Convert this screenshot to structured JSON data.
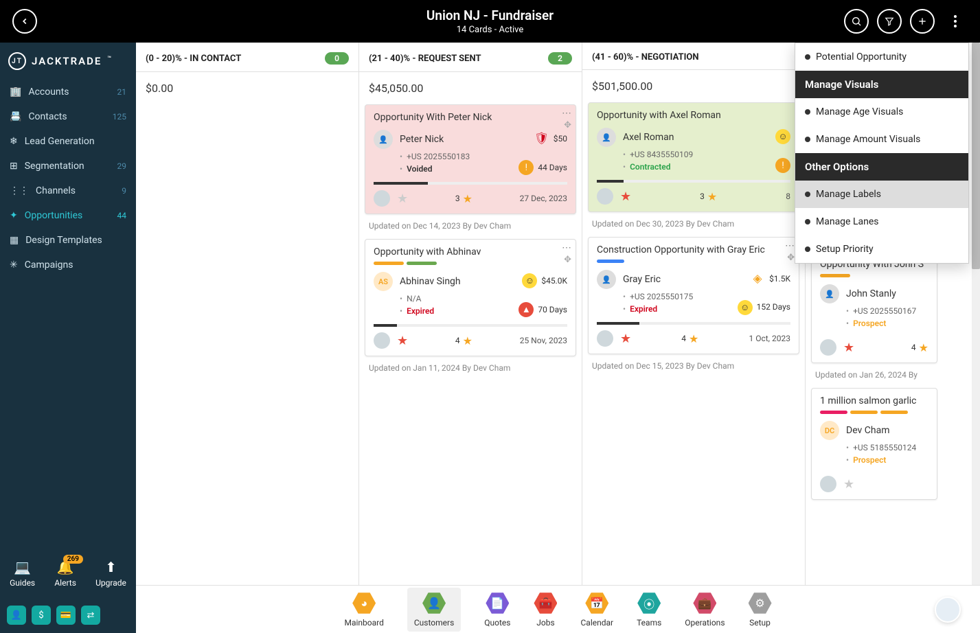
{
  "header": {
    "title": "Union NJ - Fundraiser",
    "subtitle": "14 Cards - Active"
  },
  "brand": "JACKTRADE",
  "sidebar": [
    {
      "label": "Accounts",
      "count": "21"
    },
    {
      "label": "Contacts",
      "count": "125"
    },
    {
      "label": "Lead Generation",
      "count": ""
    },
    {
      "label": "Segmentation",
      "count": "29"
    },
    {
      "label": "Channels",
      "count": "9"
    },
    {
      "label": "Opportunities",
      "count": "44",
      "active": true
    },
    {
      "label": "Design Templates",
      "count": ""
    },
    {
      "label": "Campaigns",
      "count": ""
    }
  ],
  "sidebar_bottom": [
    {
      "label": "Guides"
    },
    {
      "label": "Alerts",
      "badge": "269"
    },
    {
      "label": "Upgrade"
    }
  ],
  "columns": [
    {
      "title": "(0 - 20)% - IN CONTACT",
      "badge": "0",
      "total": "$0.00"
    },
    {
      "title": "(21 - 40)% - REQUEST SENT",
      "badge": "2",
      "total": "$45,050.00"
    },
    {
      "title": "(41 - 60)% - NEGOTIATION",
      "badge": "",
      "total": "$501,500.00"
    },
    {
      "title": "",
      "badge": "",
      "total": ""
    }
  ],
  "c2_card1": {
    "title": "Opportunity With Peter Nick",
    "name": "Peter Nick",
    "phone": "+US 2025550183",
    "status": "Voided",
    "amount": "$50",
    "days": "44 Days",
    "rating": "3",
    "date": "27 Dec, 2023"
  },
  "c2_upd1": "Updated on Dec 14, 2023 By Dev Cham",
  "c2_card2": {
    "title": "Opportunity with Abhinav",
    "name": "Abhinav Singh",
    "initials": "AS",
    "phone": "N/A",
    "status": "Expired",
    "amount": "$45.0K",
    "days": "70 Days",
    "rating": "4",
    "date": "25 Nov, 2023"
  },
  "c2_upd2": "Updated on Jan 11, 2024 By Dev Cham",
  "c3_card1": {
    "title": "Opportunity with Axel Roman",
    "name": "Axel Roman",
    "phone": "+US 8435550109",
    "status": "Contracted",
    "rating": "3",
    "date": "8"
  },
  "c3_upd1": "Updated on Dec 30, 2023 By Dev Cham",
  "c3_card2": {
    "title": "Construction Opportunity with Gray Eric",
    "name": "Gray Eric",
    "phone": "+US 2025550175",
    "status": "Expired",
    "amount": "$1.5K",
    "days": "152 Days",
    "rating": "4",
    "date": "1 Oct, 2023"
  },
  "c3_upd2": "Updated on Dec 15, 2023 By Dev Cham",
  "c4_card1": {
    "title": "Opportunity With John S",
    "name": "John Stanly",
    "phone": "+US 2025550167",
    "status": "Prospect",
    "rating": "4"
  },
  "c4_upd1": "Updated on Jan 26, 2024 By",
  "c4_card2": {
    "title": "1 million salmon garlic",
    "name": "Dev Cham",
    "initials": "DC",
    "phone": "+US 5185550124",
    "status": "Prospect"
  },
  "dropdown": {
    "item1": "Potential Opportunity",
    "sec1": "Manage Visuals",
    "item2": "Manage Age Visuals",
    "item3": "Manage Amount Visuals",
    "sec2": "Other Options",
    "item4": "Manage Labels",
    "item5": "Manage Lanes",
    "item6": "Setup Priority"
  },
  "bottombar": [
    {
      "label": "Mainboard",
      "color": "#f5a623"
    },
    {
      "label": "Customers",
      "color": "#6aa84f",
      "active": true
    },
    {
      "label": "Quotes",
      "color": "#7b5bd6"
    },
    {
      "label": "Jobs",
      "color": "#e74c3c"
    },
    {
      "label": "Calendar",
      "color": "#f5a623"
    },
    {
      "label": "Teams",
      "color": "#1fa59e"
    },
    {
      "label": "Operations",
      "color": "#d24b69"
    },
    {
      "label": "Setup",
      "color": "#9e9e9e"
    }
  ]
}
